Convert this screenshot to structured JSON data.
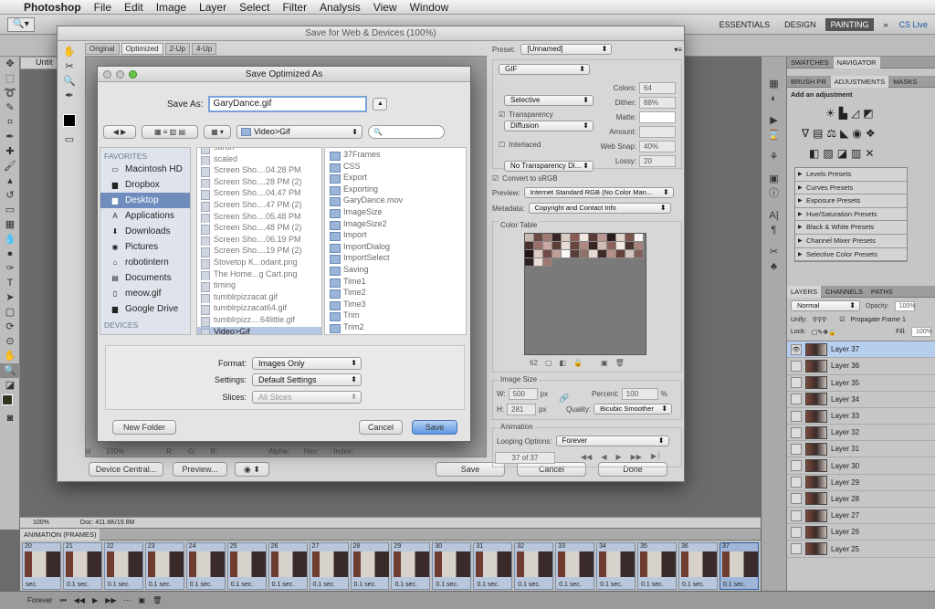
{
  "menubar": {
    "apple": "",
    "items": [
      "Photoshop",
      "File",
      "Edit",
      "Image",
      "Layer",
      "Select",
      "Filter",
      "Analysis",
      "View",
      "Window"
    ]
  },
  "workspace": {
    "buttons": [
      "ESSENTIALS",
      "DESIGN",
      "PAINTING"
    ],
    "active": "PAINTING",
    "more": "»",
    "cslive": "CS Live"
  },
  "optbar": {
    "zoom": "100%"
  },
  "doc_tab": "Untit",
  "sfw": {
    "title": "Save for Web & Devices (100%)",
    "tabs": [
      "Original",
      "Optimized",
      "2-Up",
      "4-Up"
    ],
    "active_tab": "Optimized",
    "preset_label": "Preset:",
    "preset_value": "[Unnamed]",
    "format": "GIF",
    "reduction": "Selective",
    "dither_algo": "Diffusion",
    "transparency": "Transparency",
    "no_transparency": "No Transparency Di...",
    "interlaced": "Interlaced",
    "colors_label": "Colors:",
    "colors_value": "64",
    "dither_label": "Dither:",
    "dither_value": "88%",
    "matte_label": "Matte:",
    "amount_label": "Amount:",
    "websnap_label": "Web Snap:",
    "websnap_value": "40%",
    "lossy_label": "Lossy:",
    "lossy_value": "20",
    "convert_srgb": "Convert to sRGB",
    "preview_label": "Preview:",
    "preview_value": "Internet Standard RGB (No Color Man...",
    "metadata_label": "Metadata:",
    "metadata_value": "Copyright and Contact Info",
    "color_table": "Color Table",
    "color_count": "62",
    "image_size": "Image Size",
    "w_label": "W:",
    "w_value": "500",
    "h_label": "H:",
    "h_value": "281",
    "px": "px",
    "percent_label": "Percent:",
    "percent_value": "100",
    "pct": "%",
    "quality_label": "Quality:",
    "quality_value": "Bicubic Smoother",
    "animation": "Animation",
    "looping_label": "Looping Options:",
    "looping_value": "Forever",
    "frame_counter": "37 of 37",
    "zoom": "100%",
    "r": "R:",
    "g": "G:",
    "b": "B:",
    "alpha": "Alpha:",
    "hex": "Hex:",
    "index": "Index:",
    "device_central": "Device Central...",
    "preview_btn": "Preview...",
    "save": "Save",
    "cancel": "Cancel",
    "done": "Done"
  },
  "save_as": {
    "title": "Save Optimized As",
    "save_as_label": "Save As:",
    "filename": "GaryDance.gif",
    "path": "Video>Gif",
    "sidebar_sections": [
      "FAVORITES",
      "DEVICES"
    ],
    "favorites": [
      {
        "label": "Macintosh HD",
        "icon": "hard-drive-icon"
      },
      {
        "label": "Dropbox",
        "icon": "folder-icon"
      },
      {
        "label": "Desktop",
        "icon": "folder-icon",
        "selected": true
      },
      {
        "label": "Applications",
        "icon": "applications-icon"
      },
      {
        "label": "Downloads",
        "icon": "downloads-icon"
      },
      {
        "label": "Pictures",
        "icon": "camera-icon"
      },
      {
        "label": "robotintern",
        "icon": "home-icon"
      },
      {
        "label": "Documents",
        "icon": "documents-icon"
      },
      {
        "label": "meow.gif",
        "icon": "file-icon"
      },
      {
        "label": "Google Drive",
        "icon": "folder-icon"
      }
    ],
    "files": [
      "sarah",
      "scaled",
      "Screen Sho....04.28 PM",
      "Screen Sho....28 PM (2)",
      "Screen Sho....04.47 PM",
      "Screen Sho....47 PM (2)",
      "Screen Sho....05.48 PM",
      "Screen Sho....48 PM (2)",
      "Screen Sho....06.19 PM",
      "Screen Sho....19 PM (2)",
      "Stovetop K...odant.png",
      "The Home...g Cart.png",
      "timing",
      "tumblrpizzacat.gif",
      "tumblrpizzacat64.gif",
      "tumblrpizz....64little.gif",
      "Video>Gif"
    ],
    "folders": [
      "37Frames",
      "CSS",
      "Export",
      "Exporting",
      "GaryDance.mov",
      "ImageSize",
      "ImageSize2",
      "Import",
      "ImportDialog",
      "ImportSelect",
      "Saving",
      "Time1",
      "Time2",
      "Time3",
      "Trim",
      "Trim2"
    ],
    "format_label": "Format:",
    "format_value": "Images Only",
    "settings_label": "Settings:",
    "settings_value": "Default Settings",
    "slices_label": "Slices:",
    "slices_value": "All Slices",
    "new_folder": "New Folder",
    "cancel": "Cancel",
    "save": "Save"
  },
  "panels": {
    "tabs1": [
      "SWATCHES",
      "NAVIGATOR"
    ],
    "tabs2": [
      "BRUSH PR",
      "ADJUSTMENTS",
      "MASKS"
    ],
    "add_adjustment": "Add an adjustment",
    "presets": [
      "Levels Presets",
      "Curves Presets",
      "Exposure Presets",
      "Hue/Saturation Presets",
      "Black & White Presets",
      "Channel Mixer Presets",
      "Selective Color Presets"
    ],
    "layers_tabs": [
      "LAYERS",
      "CHANNELS",
      "PATHS"
    ],
    "blend": "Normal",
    "opacity_label": "Opacity:",
    "opacity_value": "100%",
    "unify_label": "Unify:",
    "propagate": "Propagate Frame 1",
    "lock_label": "Lock:",
    "fill_label": "Fill:",
    "fill_value": "100%",
    "layers": [
      "Layer 37",
      "Layer 36",
      "Layer 35",
      "Layer 34",
      "Layer 33",
      "Layer 32",
      "Layer 31",
      "Layer 30",
      "Layer 29",
      "Layer 28",
      "Layer 27",
      "Layer 26",
      "Layer 25"
    ]
  },
  "status": {
    "zoom": "100%",
    "doc": "Doc: 411.6K/19.8M"
  },
  "animation": {
    "title": "ANIMATION (FRAMES)",
    "frames": [
      "20",
      "21",
      "22",
      "23",
      "24",
      "25",
      "26",
      "27",
      "28",
      "29",
      "30",
      "31",
      "32",
      "33",
      "34",
      "35",
      "36",
      "37"
    ],
    "delay": "0.1 sec.",
    "first_delay": "sec.",
    "loop": "Forever"
  }
}
